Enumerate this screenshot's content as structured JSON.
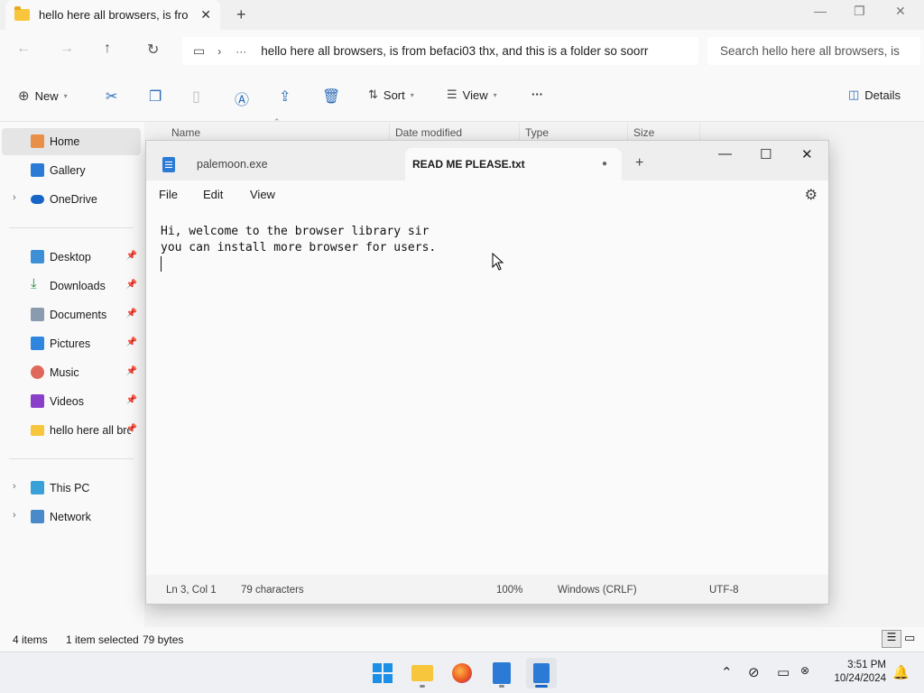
{
  "explorer": {
    "tab_title": "hello here all browsers, is from",
    "address_path": "hello here all browsers, is from befaci03 thx, and this is a folder so soorr",
    "search_placeholder": "Search hello here all browsers, is",
    "commands": {
      "new": "New",
      "sort": "Sort",
      "view": "View",
      "more": "···",
      "details": "Details"
    },
    "columns": [
      "Name",
      "Date modified",
      "Type",
      "Size"
    ],
    "nav": {
      "home": "Home",
      "gallery": "Gallery",
      "onedrive": "OneDrive",
      "desktop": "Desktop",
      "downloads": "Downloads",
      "documents": "Documents",
      "pictures": "Pictures",
      "music": "Music",
      "videos": "Videos",
      "folder": "hello here all browsers",
      "thispc": "This PC",
      "network": "Network"
    },
    "status": {
      "items": "4 items",
      "selected": "1 item selected",
      "size": "79 bytes"
    }
  },
  "notepad": {
    "tabs": [
      {
        "title": "palemoon.exe"
      },
      {
        "title": "READ ME PLEASE.txt",
        "unsaved_marker": "●"
      }
    ],
    "menu": [
      "File",
      "Edit",
      "View"
    ],
    "content_line1": "Hi, welcome to the browser library sir",
    "content_line2": "you can install more browser for users.",
    "status": {
      "position": "Ln 3, Col 1",
      "characters": "79 characters",
      "zoom": "100%",
      "line_ending": "Windows (CRLF)",
      "encoding": "UTF-8"
    }
  },
  "taskbar": {
    "time": "3:51 PM",
    "date": "10/24/2024"
  },
  "colors": {
    "accent": "#1766c7",
    "folder": "#f8c63d",
    "notepad_icon": "#2b7bd6"
  }
}
